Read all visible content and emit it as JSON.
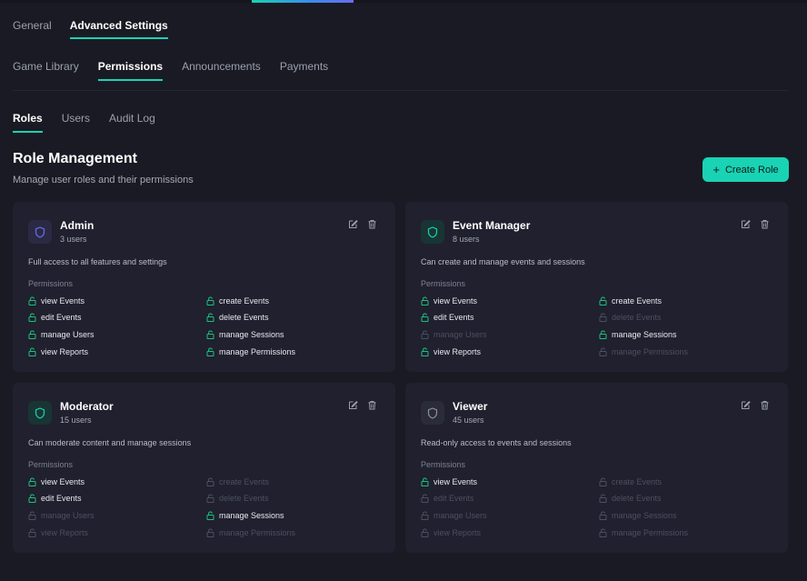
{
  "top_tabs": [
    {
      "label": "General",
      "active": false
    },
    {
      "label": "Advanced Settings",
      "active": true
    }
  ],
  "sub_tabs": [
    {
      "label": "Game Library",
      "active": false
    },
    {
      "label": "Permissions",
      "active": true
    },
    {
      "label": "Announcements",
      "active": false
    },
    {
      "label": "Payments",
      "active": false
    }
  ],
  "perm_tabs": [
    {
      "label": "Roles",
      "active": true
    },
    {
      "label": "Users",
      "active": false
    },
    {
      "label": "Audit Log",
      "active": false
    }
  ],
  "page": {
    "title": "Role Management",
    "subtitle": "Manage user roles and their permissions",
    "create_button": "Create Role"
  },
  "colors": {
    "accent": "#19d3b4",
    "admin_icon": "#6a6cf0",
    "teal_icon": "#19d3b4",
    "viewer_icon": "#8b8fa0",
    "perm_on": "#19c37d",
    "perm_off": "#4c5060"
  },
  "roles": [
    {
      "name": "Admin",
      "users": "3 users",
      "description": "Full access to all features and settings",
      "permissions_label": "Permissions",
      "icon": "shield-icon",
      "permissions": [
        {
          "label": "view Events",
          "enabled": true
        },
        {
          "label": "create Events",
          "enabled": true
        },
        {
          "label": "edit Events",
          "enabled": true
        },
        {
          "label": "delete Events",
          "enabled": true
        },
        {
          "label": "manage Users",
          "enabled": true
        },
        {
          "label": "manage Sessions",
          "enabled": true
        },
        {
          "label": "view Reports",
          "enabled": true
        },
        {
          "label": "manage Permissions",
          "enabled": true
        }
      ]
    },
    {
      "name": "Event Manager",
      "users": "8 users",
      "description": "Can create and manage events and sessions",
      "permissions_label": "Permissions",
      "icon": "shield-icon",
      "permissions": [
        {
          "label": "view Events",
          "enabled": true
        },
        {
          "label": "create Events",
          "enabled": true
        },
        {
          "label": "edit Events",
          "enabled": true
        },
        {
          "label": "delete Events",
          "enabled": false
        },
        {
          "label": "manage Users",
          "enabled": false
        },
        {
          "label": "manage Sessions",
          "enabled": true
        },
        {
          "label": "view Reports",
          "enabled": true
        },
        {
          "label": "manage Permissions",
          "enabled": false
        }
      ]
    },
    {
      "name": "Moderator",
      "users": "15 users",
      "description": "Can moderate content and manage sessions",
      "permissions_label": "Permissions",
      "icon": "shield-icon",
      "permissions": [
        {
          "label": "view Events",
          "enabled": true
        },
        {
          "label": "create Events",
          "enabled": false
        },
        {
          "label": "edit Events",
          "enabled": true
        },
        {
          "label": "delete Events",
          "enabled": false
        },
        {
          "label": "manage Users",
          "enabled": false
        },
        {
          "label": "manage Sessions",
          "enabled": true
        },
        {
          "label": "view Reports",
          "enabled": false
        },
        {
          "label": "manage Permissions",
          "enabled": false
        }
      ]
    },
    {
      "name": "Viewer",
      "users": "45 users",
      "description": "Read-only access to events and sessions",
      "permissions_label": "Permissions",
      "icon": "shield-icon",
      "permissions": [
        {
          "label": "view Events",
          "enabled": true
        },
        {
          "label": "create Events",
          "enabled": false
        },
        {
          "label": "edit Events",
          "enabled": false
        },
        {
          "label": "delete Events",
          "enabled": false
        },
        {
          "label": "manage Users",
          "enabled": false
        },
        {
          "label": "manage Sessions",
          "enabled": false
        },
        {
          "label": "view Reports",
          "enabled": false
        },
        {
          "label": "manage Permissions",
          "enabled": false
        }
      ]
    }
  ]
}
